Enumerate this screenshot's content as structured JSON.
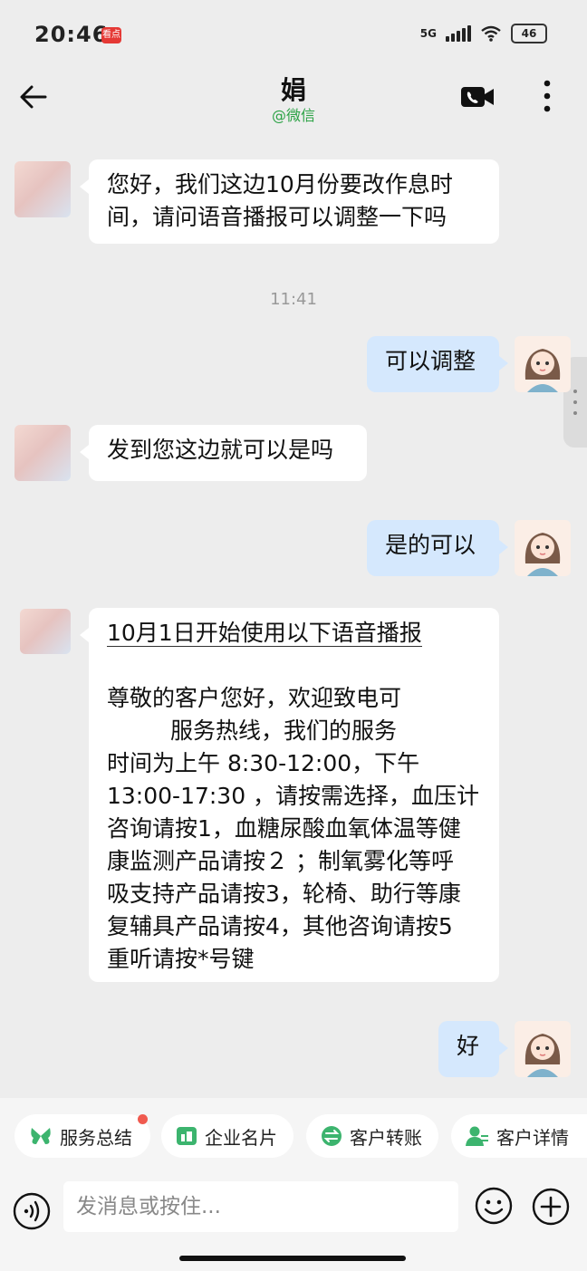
{
  "status_bar": {
    "time": "20:46",
    "app_badge": "看点",
    "network": "5G",
    "battery": "46"
  },
  "header": {
    "title": "娟",
    "subtitle": "@微信"
  },
  "messages": [
    {
      "side": "left",
      "lines": [
        "您好，我们这边10月份要改作息时",
        "间，请问语音播报可以调整一下吗"
      ]
    },
    {
      "side": "time",
      "text": "11:41"
    },
    {
      "side": "right",
      "lines": [
        "可以调整"
      ]
    },
    {
      "side": "left",
      "lines": [
        "发到您这边就可以是吗"
      ]
    },
    {
      "side": "right",
      "lines": [
        "是的可以"
      ]
    },
    {
      "side": "left",
      "lines": [
        "10月1日开始使用以下语音播报",
        "",
        "尊敬的客户您好，欢迎致电可",
        "服务热线，我们的服务",
        "时间为上午 8:30-12:00，下午",
        "13:00-17:30 ，请按需选择，血压计",
        "咨询请按1，血糖尿酸血氧体温等健",
        "康监测产品请按２ ；制氧雾化等呼",
        "吸支持产品请按3，轮椅、助行等康",
        "复辅具产品请按4，其他咨询请按5",
        "重听请按*号键"
      ]
    },
    {
      "side": "right",
      "lines": [
        "好"
      ]
    }
  ],
  "quick_actions": [
    {
      "label": "服务总结",
      "icon": "butterfly-icon",
      "color": "#3cb46e",
      "has_dot": true
    },
    {
      "label": "企业名片",
      "icon": "card-icon",
      "color": "#3cb46e",
      "has_dot": false
    },
    {
      "label": "客户转账",
      "icon": "transfer-icon",
      "color": "#3cb46e",
      "has_dot": false
    },
    {
      "label": "客户详情",
      "icon": "customer-icon",
      "color": "#3cb46e",
      "has_dot": false
    }
  ],
  "input": {
    "placeholder": "发消息或按住..."
  },
  "colors": {
    "accent_green": "#2ba245",
    "bubble_right": "#d5e8fd",
    "bubble_left": "#ffffff",
    "background": "#ededed"
  }
}
